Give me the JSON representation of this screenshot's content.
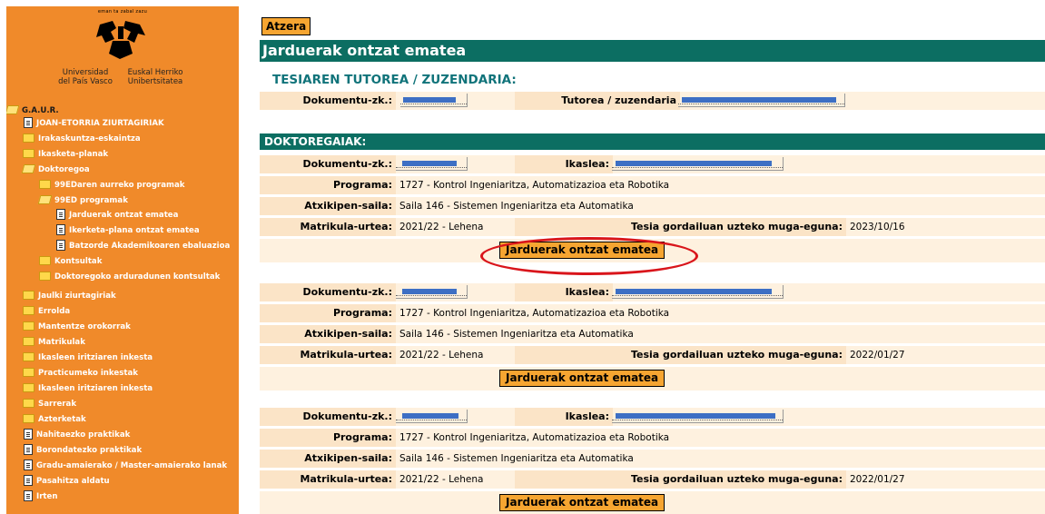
{
  "logo": {
    "motto": "eman ta zabal zazu",
    "uni_es_1": "Universidad",
    "uni_es_2": "del País Vasco",
    "uni_eu_1": "Euskal Herriko",
    "uni_eu_2": "Unibertsitatea"
  },
  "sidebar": {
    "items": [
      {
        "label": "G.A.U.R.",
        "icon": "folder-open-icon"
      },
      {
        "label": "JOAN-ETORRIA ZIURTAGIRIAK",
        "icon": "document-icon"
      },
      {
        "label": "Irakaskuntza-eskaintza",
        "icon": "folder-icon"
      },
      {
        "label": "Ikasketa-planak",
        "icon": "folder-icon"
      },
      {
        "label": "Doktoregoa",
        "icon": "folder-open-icon"
      },
      {
        "label": "99EDaren aurreko programak",
        "icon": "folder-icon"
      },
      {
        "label": "99ED programak",
        "icon": "folder-open-icon"
      },
      {
        "label": "Jarduerak ontzat ematea",
        "icon": "document-icon"
      },
      {
        "label": "Ikerketa-plana ontzat ematea",
        "icon": "document-icon"
      },
      {
        "label": "Batzorde Akademikoaren ebaluazioa",
        "icon": "document-icon"
      },
      {
        "label": "Kontsultak",
        "icon": "folder-icon"
      },
      {
        "label": "Doktoregoko arduradunen kontsultak",
        "icon": "folder-icon"
      },
      {
        "label": "Jaulki ziurtagiriak",
        "icon": "folder-icon"
      },
      {
        "label": "Errolda",
        "icon": "folder-icon"
      },
      {
        "label": "Mantentze orokorrak",
        "icon": "folder-icon"
      },
      {
        "label": "Matrikulak",
        "icon": "folder-icon"
      },
      {
        "label": "Ikasleen iritziaren inkesta",
        "icon": "folder-icon"
      },
      {
        "label": "Practicumeko inkestak",
        "icon": "folder-icon"
      },
      {
        "label": "Ikasleen iritziaren inkesta",
        "icon": "folder-icon"
      },
      {
        "label": "Sarrerak",
        "icon": "folder-icon"
      },
      {
        "label": "Azterketak",
        "icon": "folder-icon"
      },
      {
        "label": "Nahitaezko praktikak",
        "icon": "document-icon"
      },
      {
        "label": "Borondatezko praktikak",
        "icon": "document-icon"
      },
      {
        "label": "Gradu-amaierako / Master-amaierako lanak",
        "icon": "document-icon"
      },
      {
        "label": "Pasahitza aldatu",
        "icon": "document-icon"
      },
      {
        "label": "Irten",
        "icon": "document-icon"
      }
    ]
  },
  "main": {
    "back_button": "Atzera",
    "title": "Jarduerak ontzat ematea",
    "tutor_heading": "TESIAREN TUTOREA / ZUZENDARIA:",
    "tutor": {
      "doc_label": "Dokumentu-zk.:",
      "tutor_label": "Tutorea / zuzendaria"
    },
    "students_heading": "DOKTOREGAIAK:",
    "labels": {
      "doc": "Dokumentu-zk.:",
      "student": "Ikaslea:",
      "program": "Programa:",
      "dept": "Atxikipen-saila:",
      "year": "Matrikula-urtea:",
      "deadline": "Tesia gordailuan uzteko muga-eguna:"
    },
    "action_label": "Jarduerak ontzat ematea",
    "students": [
      {
        "program": "1727 - Kontrol Ingeniaritza, Automatizazioa eta Robotika",
        "dept": "Saila 146 - Sistemen Ingeniaritza eta Automatika",
        "year": "2021/22 - Lehena",
        "deadline": "2023/10/16"
      },
      {
        "program": "1727 - Kontrol Ingeniaritza, Automatizazioa eta Robotika",
        "dept": "Saila 146 - Sistemen Ingeniaritza eta Automatika",
        "year": "2021/22 - Lehena",
        "deadline": "2022/01/27"
      },
      {
        "program": "1727 - Kontrol Ingeniaritza, Automatizazioa eta Robotika",
        "dept": "Saila 146 - Sistemen Ingeniaritza eta Automatika",
        "year": "2021/22 - Lehena",
        "deadline": "2022/01/27"
      }
    ]
  },
  "colors": {
    "sidebar_bg": "#f08a2a",
    "title_bar": "#0c6e62",
    "heading_text": "#10737a",
    "button_bg": "#f6a531",
    "row_bg": "#fef1df",
    "redaction": "#3d6fc4",
    "highlight": "#d9151b"
  }
}
